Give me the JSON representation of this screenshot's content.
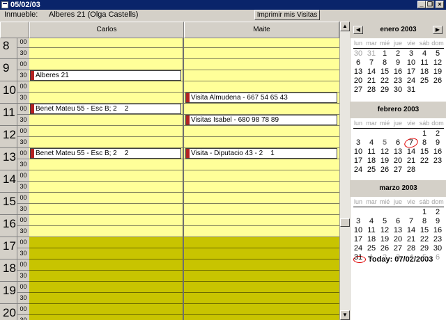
{
  "window": {
    "title": "05/02/03"
  },
  "header": {
    "label": "Inmueble:",
    "value": "Alberes 21 (Olga Castells)",
    "print_button": "Imprimir mis Visitas"
  },
  "columns": [
    "Carlos",
    "Maite"
  ],
  "hours": [
    "8",
    "9",
    "10",
    "11",
    "12",
    "13",
    "14",
    "15",
    "16",
    "17",
    "18",
    "19",
    "20"
  ],
  "minute_labels": [
    "00",
    "30"
  ],
  "appointments": [
    {
      "text": "Alberes 21"
    },
    {
      "text": "Benet Mateu 55 - Esc B; 2    2"
    },
    {
      "text": "Benet Mateu 55 - Esc B; 2    2"
    },
    {
      "text": "Visita Almudena - 667 54 65 43"
    },
    {
      "text": "Visitas Isabel - 680 98 78 89"
    },
    {
      "text": "Visita - Diputacio 43 - 2    1"
    }
  ],
  "weekdays": [
    "lun",
    "mar",
    "mié",
    "jue",
    "vie",
    "sáb",
    "dom"
  ],
  "months": [
    {
      "name": "enero 2003",
      "weeks": [
        [
          "30",
          "31",
          "1",
          "2",
          "3",
          "4",
          "5"
        ],
        [
          "6",
          "7",
          "8",
          "9",
          "10",
          "11",
          "12"
        ],
        [
          "13",
          "14",
          "15",
          "16",
          "17",
          "18",
          "19"
        ],
        [
          "20",
          "21",
          "22",
          "23",
          "24",
          "25",
          "26"
        ],
        [
          "27",
          "28",
          "29",
          "30",
          "31",
          "",
          ""
        ]
      ]
    },
    {
      "name": "febrero 2003",
      "weeks": [
        [
          "",
          "",
          "",
          "",
          "",
          "1",
          "2"
        ],
        [
          "3",
          "4",
          "5",
          "6",
          "7",
          "8",
          "9"
        ],
        [
          "10",
          "11",
          "12",
          "13",
          "14",
          "15",
          "16"
        ],
        [
          "17",
          "18",
          "19",
          "20",
          "21",
          "22",
          "23"
        ],
        [
          "24",
          "25",
          "26",
          "27",
          "28",
          "",
          ""
        ]
      ]
    },
    {
      "name": "marzo 2003",
      "weeks": [
        [
          "",
          "",
          "",
          "",
          "",
          "1",
          "2"
        ],
        [
          "3",
          "4",
          "5",
          "6",
          "7",
          "8",
          "9"
        ],
        [
          "10",
          "11",
          "12",
          "13",
          "14",
          "15",
          "16"
        ],
        [
          "17",
          "18",
          "19",
          "20",
          "21",
          "22",
          "23"
        ],
        [
          "24",
          "25",
          "26",
          "27",
          "28",
          "29",
          "30"
        ],
        [
          "31",
          "1",
          "2",
          "3",
          "4",
          "5",
          "6"
        ]
      ]
    }
  ],
  "today_text": "Today: 07/02/2003",
  "colors": {
    "titlebar": "#0a246a",
    "day_slot": "#ffff99",
    "evening_slot": "#c8c400",
    "appointment_marker": "#b22222",
    "today_circle": "#e00000"
  }
}
